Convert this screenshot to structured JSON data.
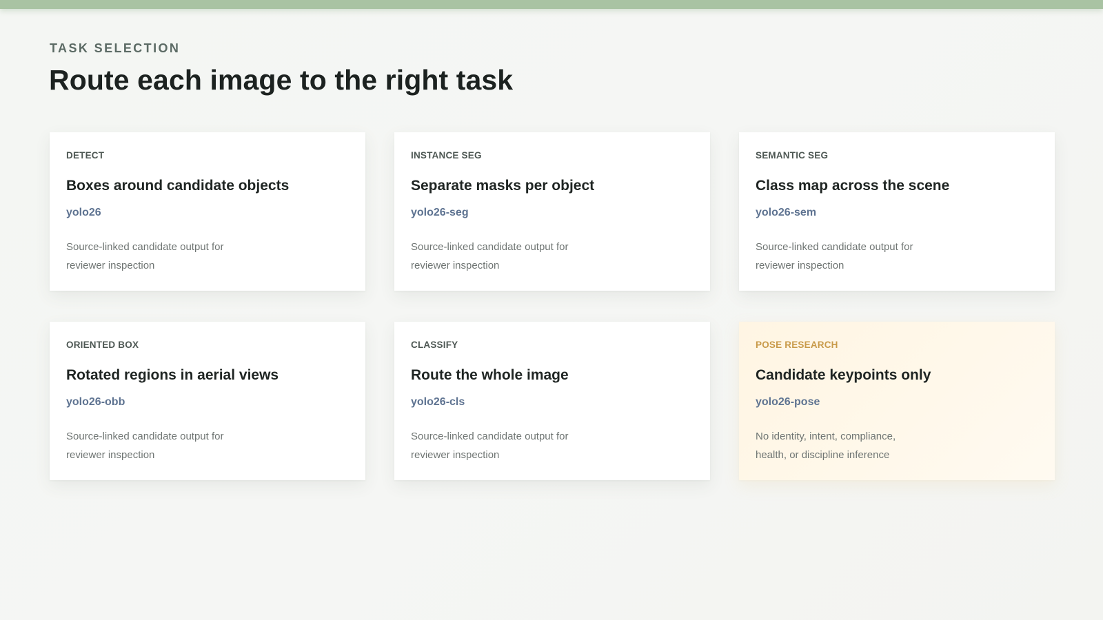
{
  "header": {
    "eyebrow": "TASK SELECTION",
    "title": "Route each image to the right task"
  },
  "colors": {
    "accent_bar": "#a9c3a3",
    "model_text": "#5e7391",
    "warning_tag": "#c89a49",
    "warning_bg": "#fff6e6"
  },
  "cards": [
    {
      "tag": "DETECT",
      "title": "Boxes around candidate objects",
      "model": "yolo26",
      "description": "Source-linked candidate output for reviewer inspection"
    },
    {
      "tag": "INSTANCE SEG",
      "title": "Separate masks per object",
      "model": "yolo26-seg",
      "description": "Source-linked candidate output for reviewer inspection"
    },
    {
      "tag": "SEMANTIC SEG",
      "title": "Class map across the scene",
      "model": "yolo26-sem",
      "description": "Source-linked candidate output for reviewer inspection"
    },
    {
      "tag": "ORIENTED BOX",
      "title": "Rotated regions in aerial views",
      "model": "yolo26-obb",
      "description": "Source-linked candidate output for reviewer inspection"
    },
    {
      "tag": "CLASSIFY",
      "title": "Route the whole image",
      "model": "yolo26-cls",
      "description": "Source-linked candidate output for reviewer inspection"
    },
    {
      "tag": "POSE RESEARCH",
      "title": "Candidate keypoints only",
      "model": "yolo26-pose",
      "description": "No identity, intent, compliance, health, or discipline inference"
    }
  ]
}
